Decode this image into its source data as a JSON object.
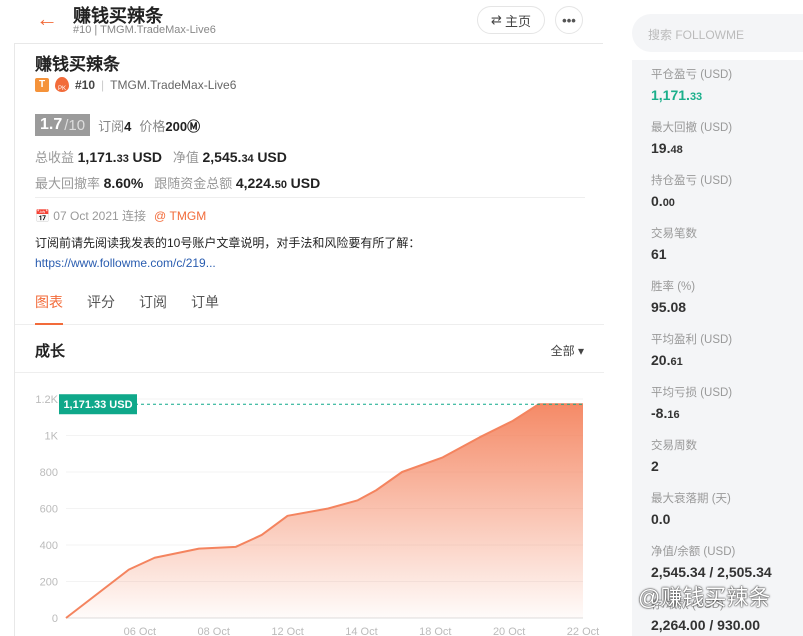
{
  "header": {
    "title": "赚钱买辣条",
    "rank": "#10",
    "server": "TMGM.TradeMax-Live6",
    "home_label": "主页",
    "home_icon": "swap-icon",
    "more_icon": "more-icon",
    "back_icon": "arrow-left-icon"
  },
  "profile": {
    "name": "赚钱买辣条",
    "badge_t": "T",
    "badge_pk": "PK",
    "rank": "#10",
    "server": "TMGM.TradeMax-Live6",
    "score": "1.7",
    "score_max": "/10",
    "subs_label": "订阅",
    "subs": "4",
    "price_label": "价格",
    "price": "200",
    "total_profit_label": "总收益",
    "total_profit_int": "1,171.",
    "total_profit_dec": "33",
    "total_profit_unit": "USD",
    "equity_label": "净值",
    "equity_int": "2,545.",
    "equity_dec": "34",
    "equity_unit": "USD",
    "max_dd_label": "最大回撤率",
    "max_dd": "8.60%",
    "follow_label": "跟随资金总额",
    "follow_int": "4,224.",
    "follow_dec": "50",
    "follow_unit": "USD",
    "connected_date": "07 Oct 2021 连接",
    "broker": "@ TMGM",
    "description": "订阅前请先阅读我发表的10号账户文章说明，对手法和风险要有所了解：",
    "link": "https://www.followme.com/c/219..."
  },
  "tabs": [
    {
      "label": "图表",
      "active": true
    },
    {
      "label": "评分"
    },
    {
      "label": "订阅"
    },
    {
      "label": "订单"
    }
  ],
  "section": {
    "title": "成长",
    "range": "全部 ▾"
  },
  "search": {
    "placeholder": "搜索 FOLLOWME"
  },
  "stats": [
    {
      "label": "平仓盈亏 (USD)",
      "int": "1,171.",
      "dec": "33",
      "green": true
    },
    {
      "label": "最大回撤 (USD)",
      "int": "19.",
      "dec": "48"
    },
    {
      "label": "持仓盈亏 (USD)",
      "int": "0.",
      "dec": "00"
    },
    {
      "label": "交易笔数",
      "int": "61",
      "dec": ""
    },
    {
      "label": "胜率 (%)",
      "int": "95.08",
      "dec": ""
    },
    {
      "label": "平均盈利 (USD)",
      "int": "20.",
      "dec": "61"
    },
    {
      "label": "平均亏损 (USD)",
      "int": "-8.",
      "dec": "16"
    },
    {
      "label": "交易周数",
      "int": "2",
      "dec": ""
    },
    {
      "label": "最大衰落期 (天)",
      "int": "0.0",
      "dec": ""
    },
    {
      "label": "净值/余额 (USD)",
      "int": "2,545.34 / 2,505.34",
      "dec": ""
    },
    {
      "label": "存/取款 (USD)",
      "int": "2,264.00 / 930.00",
      "dec": ""
    }
  ],
  "watermark": "@赚钱买辣条",
  "chart_data": {
    "type": "area",
    "title": "成长",
    "ylim": [
      0,
      1200
    ],
    "yticks": [
      0,
      200,
      400,
      600,
      800,
      1000,
      1200
    ],
    "ytick_labels": [
      "0",
      "200",
      "400",
      "600",
      "800",
      "1K",
      "1.2K"
    ],
    "xlim": [
      0,
      14
    ],
    "xticks": [
      2,
      4,
      6,
      8,
      10,
      12,
      14
    ],
    "xtick_labels": [
      "06 Oct",
      "08 Oct",
      "12 Oct",
      "14 Oct",
      "18 Oct",
      "20 Oct",
      "22 Oct"
    ],
    "x": [
      0,
      1.7,
      2.4,
      3.6,
      4.6,
      5.3,
      6,
      7.1,
      7.9,
      8.4,
      9.1,
      10.2,
      11.2,
      12.1,
      12.8,
      14
    ],
    "y": [
      0,
      265,
      330,
      380,
      390,
      455,
      560,
      600,
      645,
      700,
      800,
      880,
      990,
      1080,
      1171.33,
      1171.33
    ],
    "marker_label": "1,171.33 USD",
    "marker_value": 1171.33,
    "line_color": "#f4845f",
    "marker_color": "#0fa88a"
  }
}
